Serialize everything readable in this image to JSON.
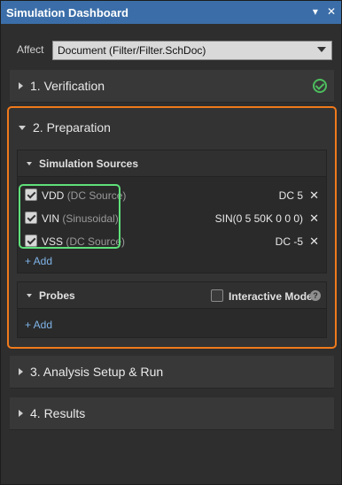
{
  "titlebar": {
    "title": "Simulation Dashboard",
    "pin": "▾",
    "close": "✕"
  },
  "affect": {
    "label": "Affect",
    "value": "Document (Filter/Filter.SchDoc)"
  },
  "sections": {
    "verification": {
      "label": "1. Verification",
      "status": "passed"
    },
    "preparation": {
      "label": "2. Preparation"
    },
    "analysis": {
      "label": "3. Analysis Setup & Run"
    },
    "results": {
      "label": "4. Results"
    }
  },
  "sources": {
    "header": "Simulation Sources",
    "items": [
      {
        "name": "VDD",
        "type": "(DC Source)",
        "value": "DC 5",
        "checked": true
      },
      {
        "name": "VIN",
        "type": "(Sinusoidal)",
        "value": "SIN(0 5 50K 0 0 0)",
        "checked": true
      },
      {
        "name": "VSS",
        "type": "(DC Source)",
        "value": "DC -5",
        "checked": true
      }
    ],
    "add": "+ Add"
  },
  "probes": {
    "header": "Probes",
    "interactive_mode": "Interactive Mode",
    "help": "?",
    "add": "+ Add"
  },
  "colors": {
    "titlebar": "#3b6ea8",
    "highlight_orange": "#f07a1c",
    "highlight_green": "#5fe07a",
    "link": "#7fb4e8",
    "ok": "#4dbd5e"
  }
}
